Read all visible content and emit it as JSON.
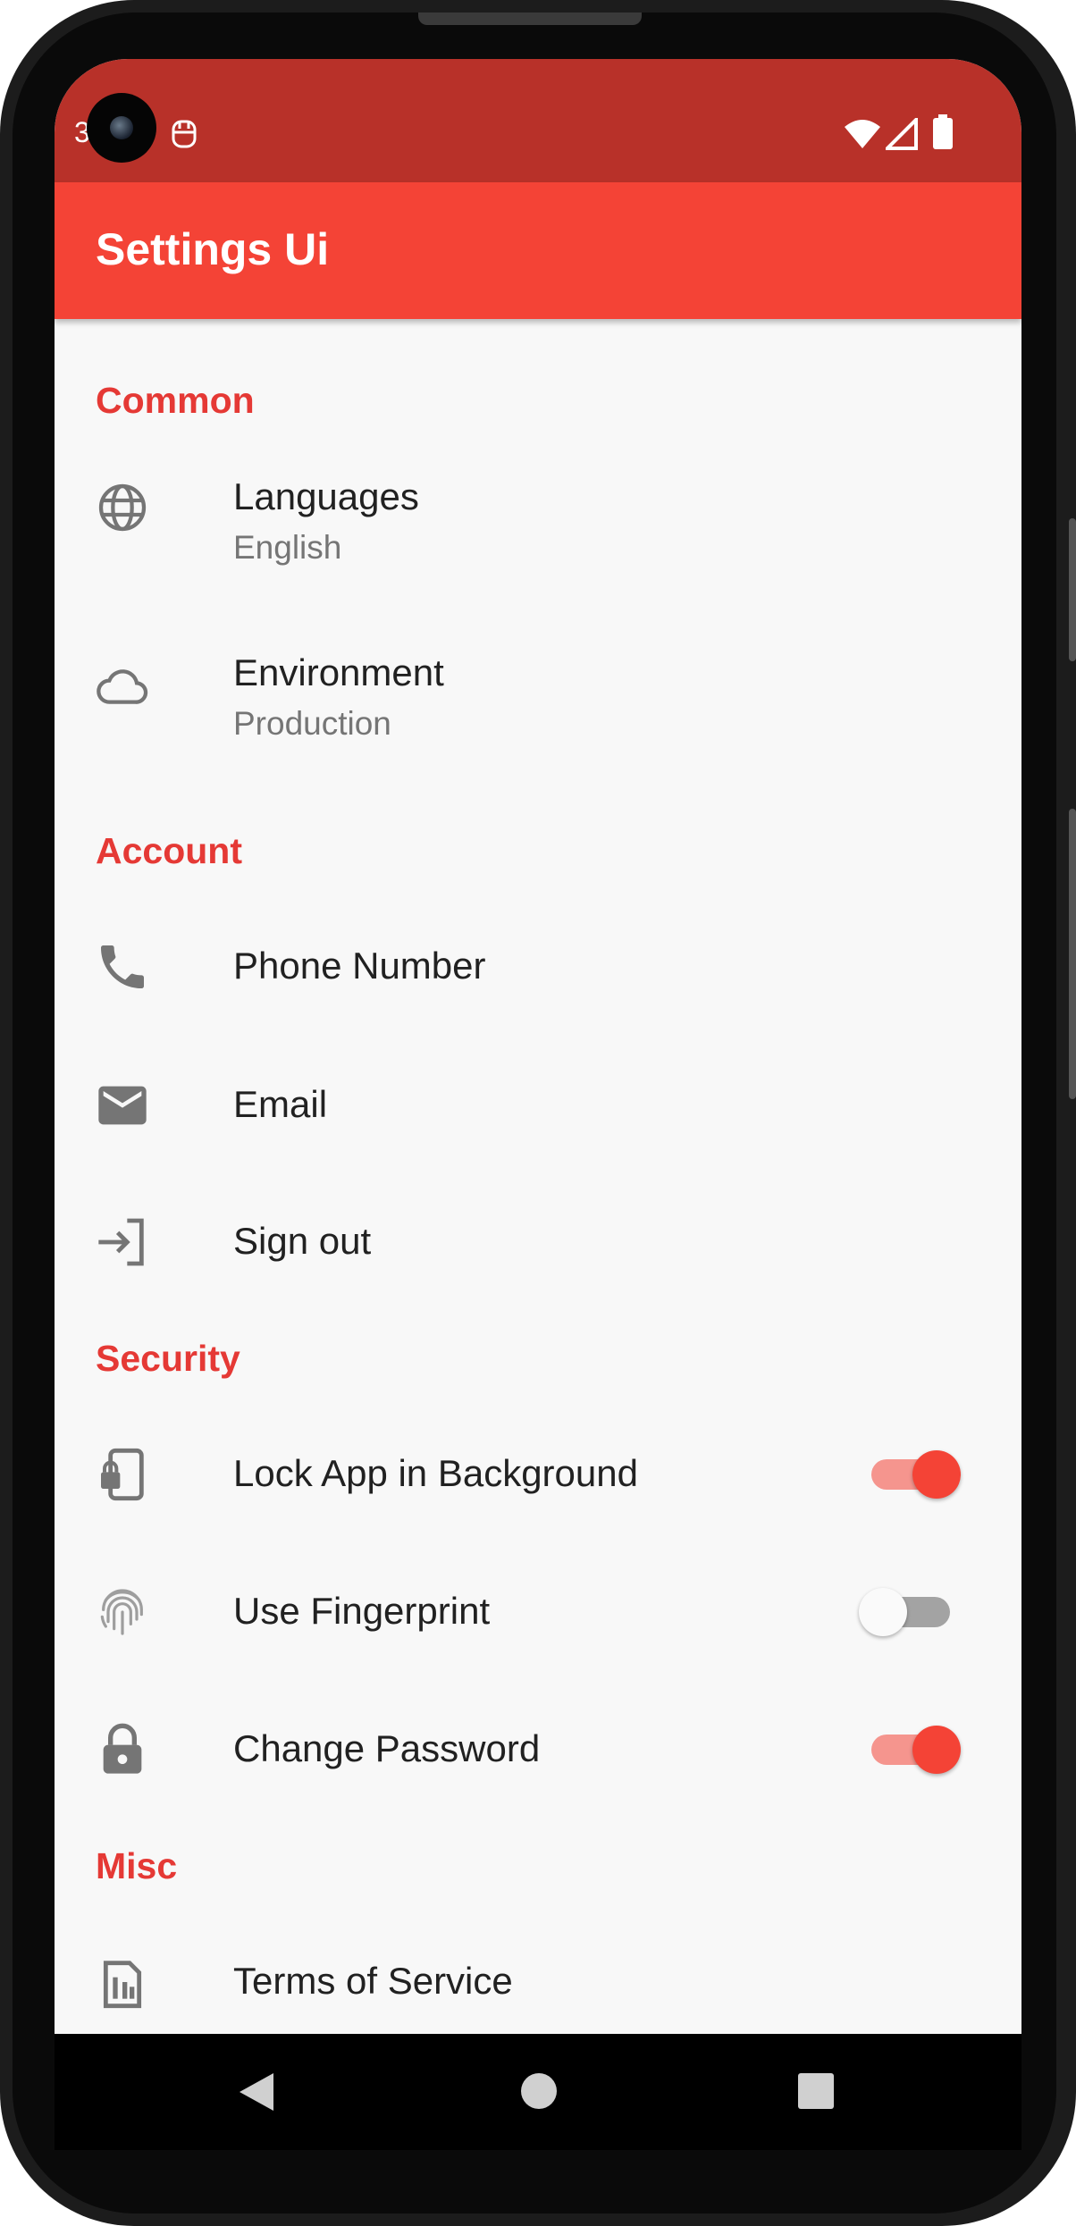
{
  "status_bar": {
    "time": "3"
  },
  "app_bar": {
    "title": "Settings Ui"
  },
  "sections": {
    "common": {
      "header": "Common",
      "languages": {
        "title": "Languages",
        "subtitle": "English",
        "icon": "globe-icon"
      },
      "environment": {
        "title": "Environment",
        "subtitle": "Production",
        "icon": "cloud-icon"
      }
    },
    "account": {
      "header": "Account",
      "phone": {
        "title": "Phone Number",
        "icon": "phone-icon"
      },
      "email": {
        "title": "Email",
        "icon": "mail-icon"
      },
      "sign_out": {
        "title": "Sign out",
        "icon": "sign-out-icon"
      }
    },
    "security": {
      "header": "Security",
      "lock_app": {
        "title": "Lock App in Background",
        "icon": "phone-lock-icon",
        "enabled": true
      },
      "fingerprint": {
        "title": "Use Fingerprint",
        "icon": "fingerprint-icon",
        "enabled": false
      },
      "change_password": {
        "title": "Change Password",
        "icon": "lock-icon",
        "enabled": true
      }
    },
    "misc": {
      "header": "Misc",
      "terms": {
        "title": "Terms of Service",
        "icon": "document-icon"
      }
    }
  },
  "colors": {
    "primary": "#f44336",
    "status_bar": "#b83129",
    "section_header": "#e53935",
    "background": "#f8f8f8",
    "icon": "#757575"
  }
}
